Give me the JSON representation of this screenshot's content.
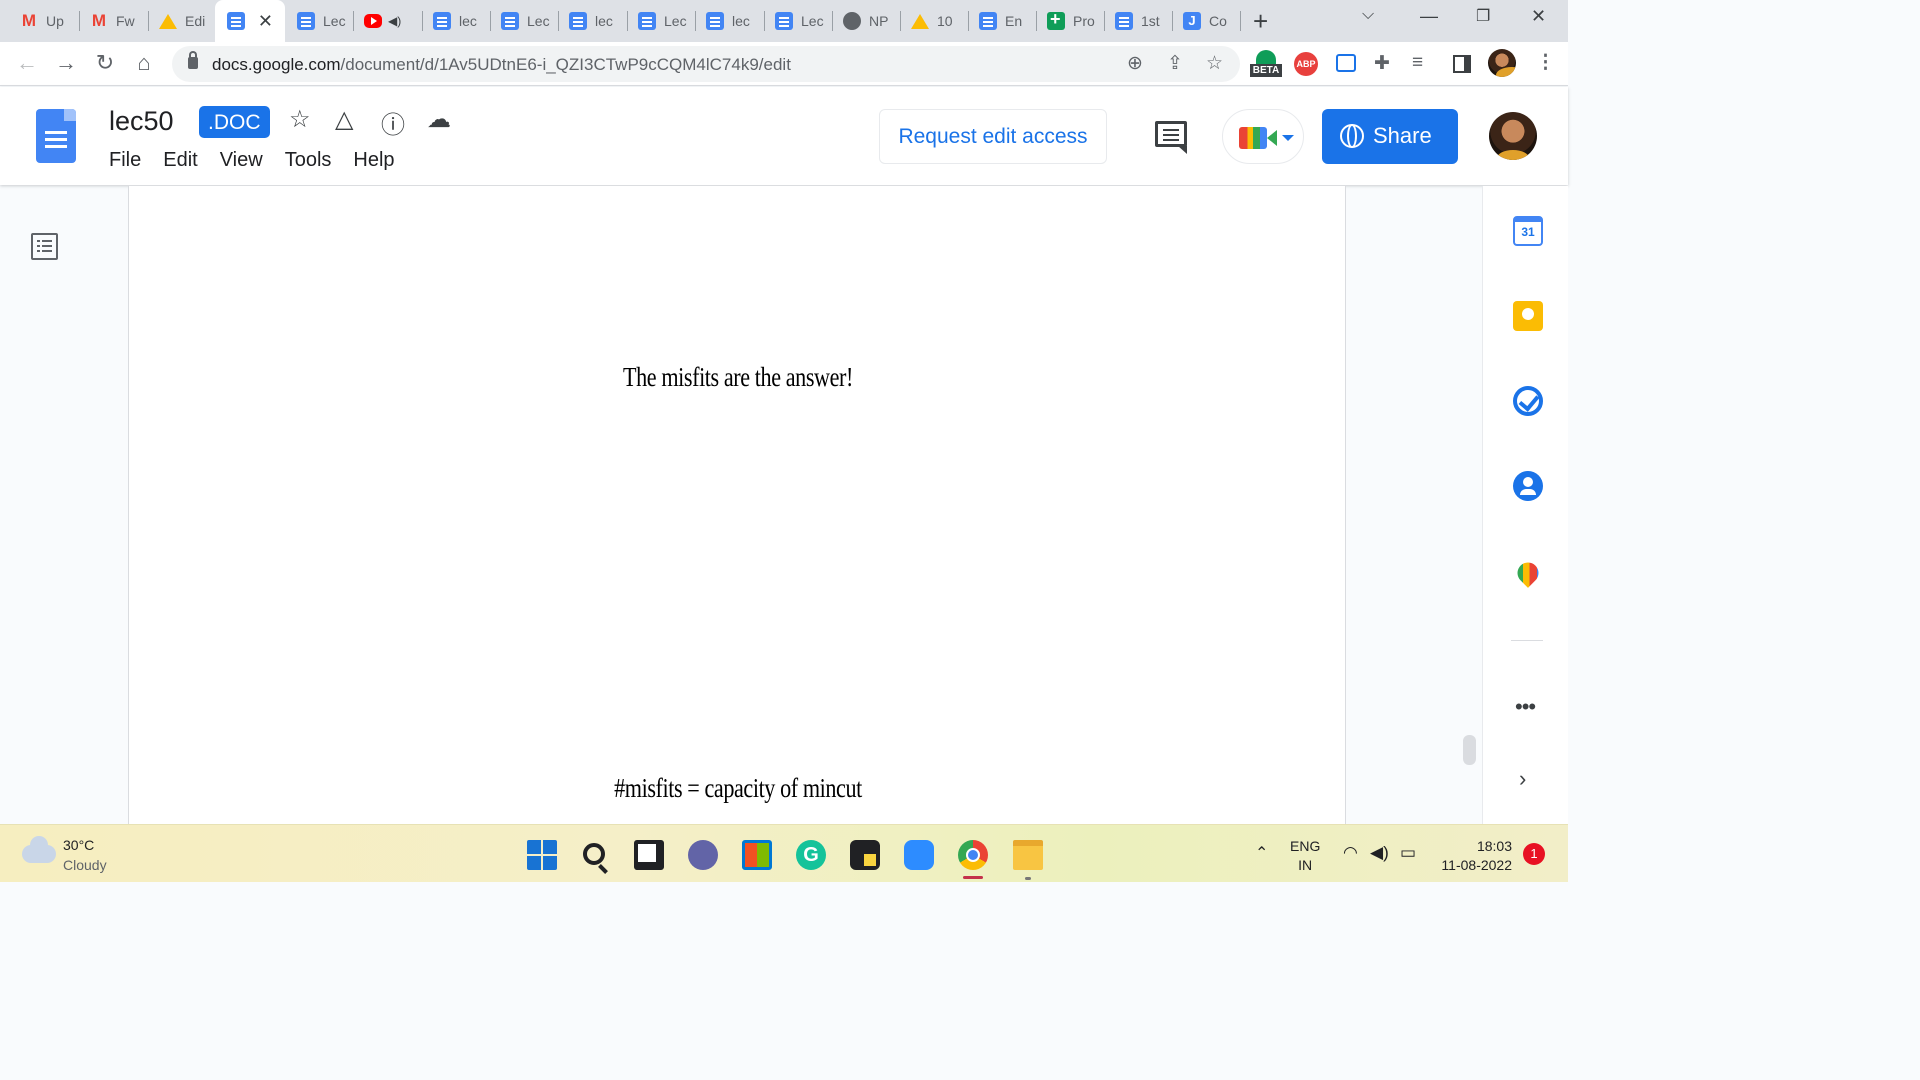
{
  "browser": {
    "tabs": [
      {
        "label": "Up",
        "icon": "gmail-icon",
        "active": false
      },
      {
        "label": "Fw",
        "icon": "gmail-icon",
        "active": false
      },
      {
        "label": "Edi",
        "icon": "drive-icon",
        "active": false
      },
      {
        "label": "",
        "icon": "docs-icon",
        "active": true
      },
      {
        "label": "Lec",
        "icon": "docs-icon",
        "active": false
      },
      {
        "label": "",
        "icon": "youtube-icon",
        "active": false,
        "audio": true
      },
      {
        "label": "lec",
        "icon": "docs-icon",
        "active": false
      },
      {
        "label": "Lec",
        "icon": "docs-icon",
        "active": false
      },
      {
        "label": "lec",
        "icon": "docs-icon",
        "active": false
      },
      {
        "label": "Lec",
        "icon": "docs-icon",
        "active": false
      },
      {
        "label": "lec",
        "icon": "docs-icon",
        "active": false
      },
      {
        "label": "Lec",
        "icon": "docs-icon",
        "active": false
      },
      {
        "label": "NP",
        "icon": "globe-icon",
        "active": false
      },
      {
        "label": "10",
        "icon": "drive-icon",
        "active": false
      },
      {
        "label": "En",
        "icon": "docs-icon",
        "active": false
      },
      {
        "label": "Pro",
        "icon": "sheets-icon",
        "active": false
      },
      {
        "label": "1st",
        "icon": "docs-icon",
        "active": false
      },
      {
        "label": "Co",
        "icon": "jamboard-icon",
        "active": false
      }
    ],
    "close_glyph": "✕",
    "new_tab_glyph": "+",
    "url_host": "docs.google.com",
    "url_path": "/document/d/1Av5UDtnE6-i_QZI3CTwP9cCQM4lC74k9/edit",
    "ext_beta_label": "BETA",
    "ext_abp_label": "ABP"
  },
  "docs": {
    "title": "lec50",
    "badge": ".DOC",
    "menu": [
      "File",
      "Edit",
      "View",
      "Tools",
      "Help"
    ],
    "request_edit_label": "Request edit access",
    "share_label": "Share",
    "accent_color": "#1a73e8"
  },
  "document": {
    "lines": [
      "The misfits are the answer!",
      "#misfits = capacity of mincut"
    ]
  },
  "side_panel": {
    "calendar_day": "31",
    "more_glyph": "•••",
    "expand_glyph": "›"
  },
  "taskbar": {
    "temperature": "30°C",
    "condition": "Cloudy",
    "language": "ENG",
    "region": "IN",
    "time": "18:03",
    "date": "11-08-2022",
    "notification_count": "1"
  }
}
